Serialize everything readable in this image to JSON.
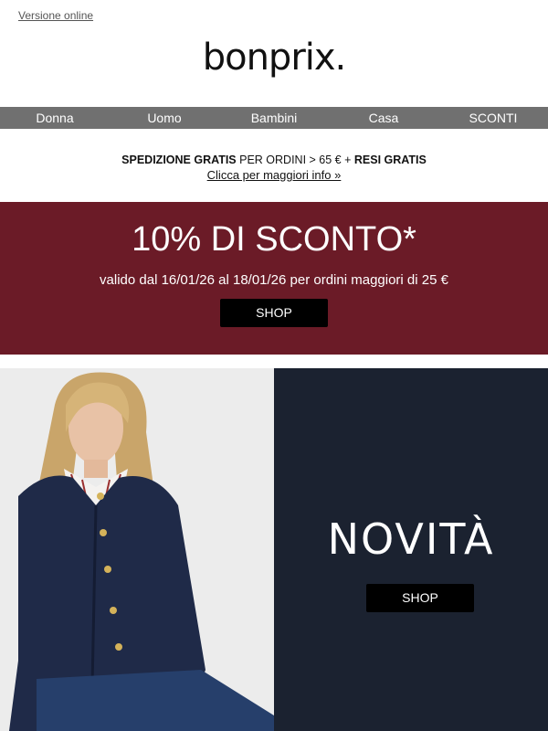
{
  "header": {
    "online_link": "Versione online",
    "logo": "bonprix."
  },
  "nav": {
    "items": [
      "Donna",
      "Uomo",
      "Bambini",
      "Casa",
      "SCONTI"
    ]
  },
  "promo": {
    "bold1": "SPEDIZIONE GRATIS",
    "normal": " PER ORDINI > 65 € + ",
    "bold2": "RESI GRATIS",
    "link": "Clicca per maggiori info »"
  },
  "banner": {
    "title": "10% DI SCONTO*",
    "subtitle": "valido dal 16/01/26 al 18/01/26 per ordini maggiori di 25 €",
    "button": "SHOP",
    "bg_color": "#6b1b27"
  },
  "feature": {
    "title": "NOVITÀ",
    "button": "SHOP",
    "bg_color": "#1b2230"
  }
}
